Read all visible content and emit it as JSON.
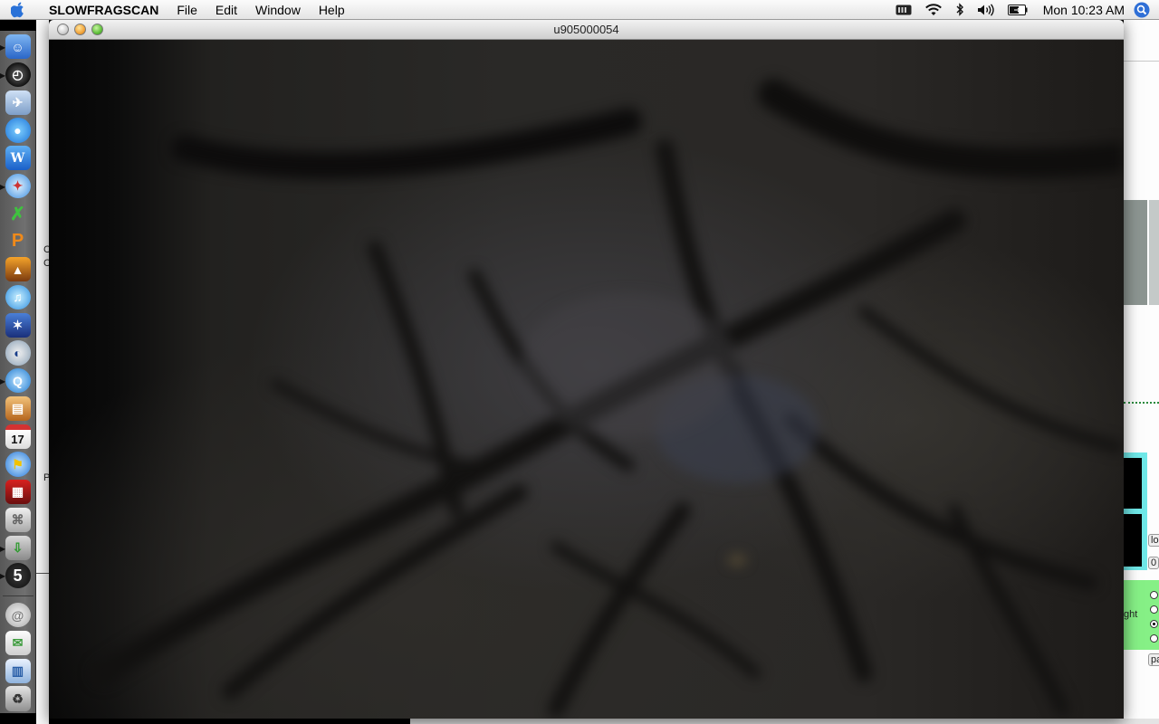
{
  "menubar": {
    "app_name": "SLOWFRAGSCAN",
    "menus": [
      "File",
      "Edit",
      "Window",
      "Help"
    ],
    "clock": "Mon 10:23 AM",
    "status_icons": [
      "battery-meter-icon",
      "wifi-icon",
      "bluetooth-icon",
      "volume-icon",
      "battery-icon",
      "spotlight-icon"
    ]
  },
  "window": {
    "title": "u905000054"
  },
  "dock": {
    "icons": [
      "finder-icon",
      "dashboard-icon",
      "mail-icon",
      "ichat-icon",
      "word-icon",
      "safari-icon",
      "itunes-x-icon",
      "paint-icon",
      "photo-booth-icon",
      "itunes-icon",
      "imovie-icon",
      "helmet-icon",
      "quicktime-icon",
      "iphoto-icon",
      "ical-icon",
      "ichat-av-icon",
      "flash-icon",
      "system-prefs-icon",
      "installer-icon",
      "five-icon",
      "mail-at-icon",
      "documents-icon",
      "applications-icon",
      "trash-icon"
    ],
    "badge_five": "5",
    "ical_day": "17"
  },
  "background": {
    "right_labels": [
      "lo",
      "0",
      "ght",
      "pa"
    ],
    "left_letters": [
      "C",
      "C",
      "P"
    ]
  },
  "colors": {
    "menubar": "#ececec",
    "dock": "#656565",
    "video_dark": "#0b0b0b",
    "bg_green": "#86f086",
    "bg_cyan": "#6fe8e8"
  }
}
